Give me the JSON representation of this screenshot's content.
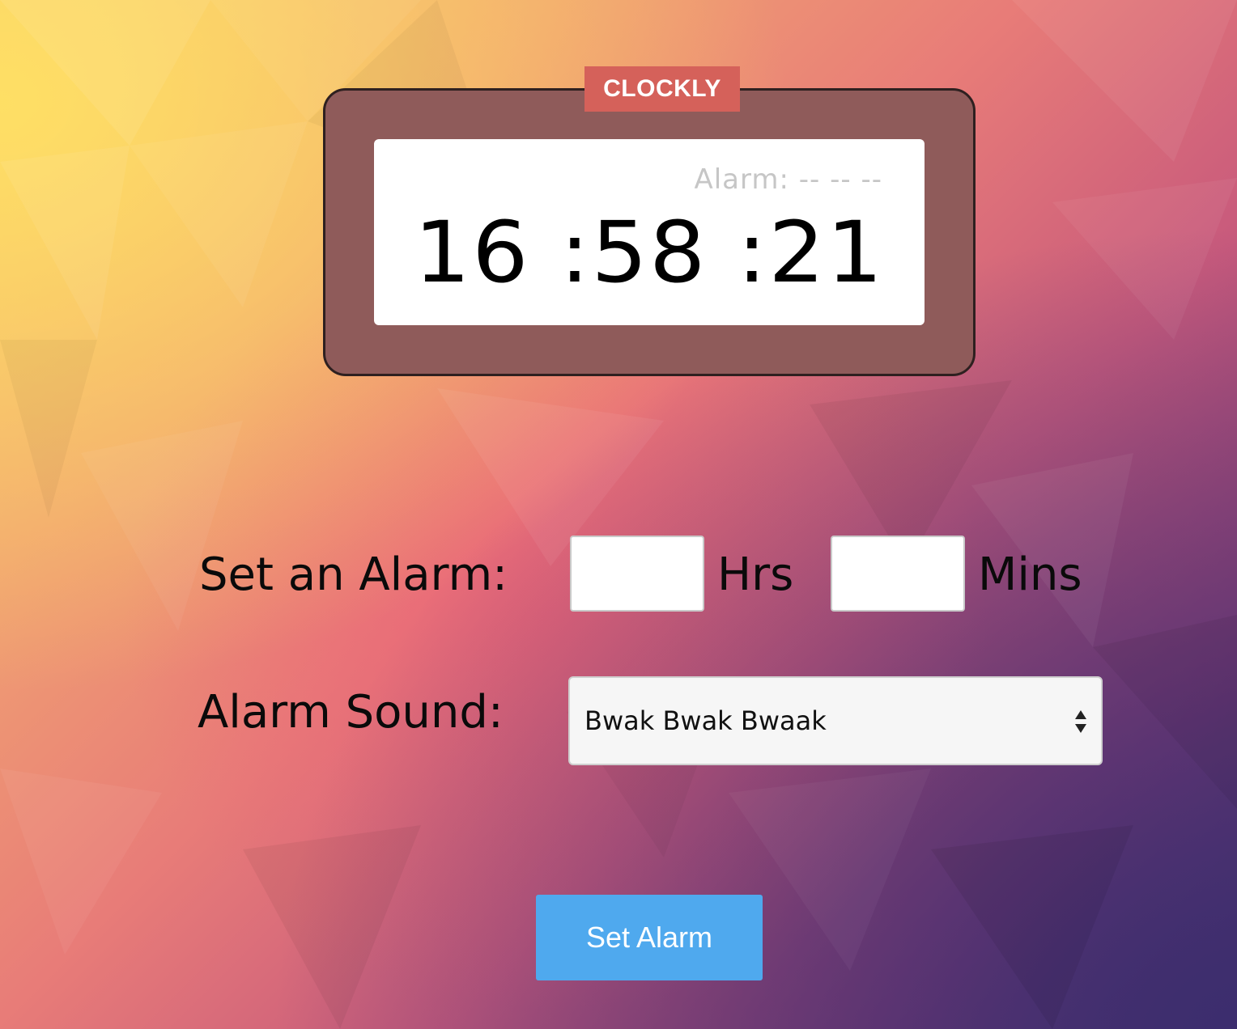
{
  "app": {
    "brand": "CLOCKLY"
  },
  "clock": {
    "alarm_readout": "Alarm: -- -- --",
    "time": "16 :58 :21"
  },
  "form": {
    "set_alarm_label": "Set an Alarm:",
    "hours_unit": "Hrs",
    "minutes_unit": "Mins",
    "hours_value": "",
    "minutes_value": "",
    "sound_label": "Alarm Sound:",
    "sound_selected": "Bwak Bwak Bwaak",
    "submit_label": "Set Alarm"
  },
  "colors": {
    "frame": "#8f5b5a",
    "brand_tag": "#d5615a",
    "button": "#4fa9ee"
  }
}
